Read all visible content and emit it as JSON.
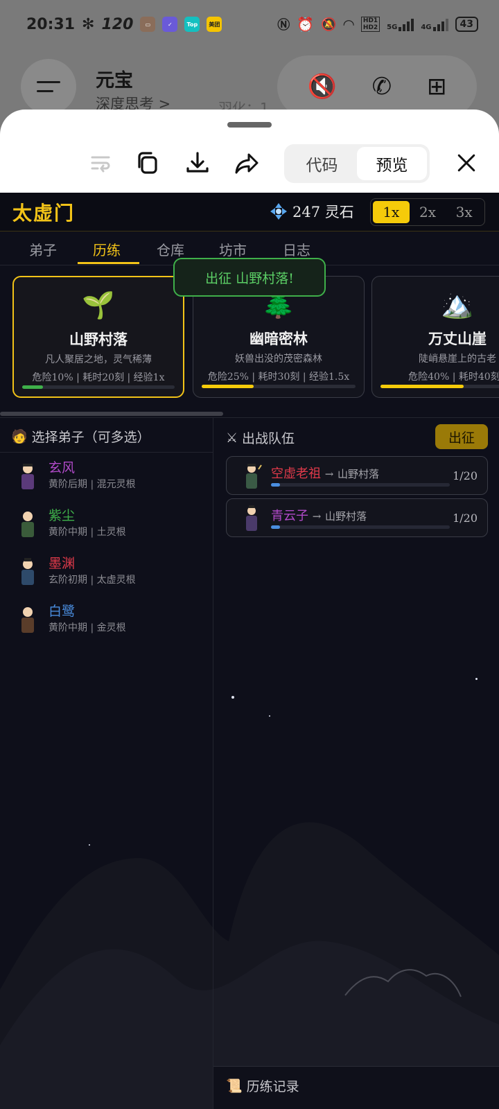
{
  "status_bar": {
    "time": "20:31",
    "refresh_rate": "120",
    "network_5g": "5G",
    "network_4g": "4G",
    "hd1": "HD1",
    "hd2": "HD2",
    "battery": "43"
  },
  "chat_header": {
    "bot_name": "元宝",
    "subtitle": "深度思考 >",
    "ghost_text": "羽化：1"
  },
  "sheet": {
    "view_tabs": [
      "代码",
      "预览"
    ],
    "active_view": "预览"
  },
  "game": {
    "sect_name": "太虚门",
    "spirit_stones": "247 灵石",
    "speed_options": [
      "1x",
      "2x",
      "3x"
    ],
    "active_speed": "1x",
    "tabs": [
      "弟子",
      "历练",
      "仓库",
      "坊市",
      "日志"
    ],
    "active_tab": "历练",
    "toast": "出征 山野村落!",
    "locations": [
      {
        "emoji": "🌱",
        "name": "山野村落",
        "desc": "凡人聚居之地，灵气稀薄",
        "stats": "危险10% | 耗时20刻 | 经验1x",
        "danger": 0.1,
        "bar_color": "#3fb04a",
        "selected": true
      },
      {
        "emoji": "🌲",
        "name": "幽暗密林",
        "desc": "妖兽出没的茂密森林",
        "stats": "危险25% | 耗时30刻 | 经验1.5x",
        "danger": 0.25,
        "bar_color": "#f5cb0a",
        "selected": false
      },
      {
        "emoji": "🏔️",
        "name": "万丈山崖",
        "desc": "陡峭悬崖上的古老",
        "stats": "危险40% | 耗时40刻 |",
        "danger": 0.4,
        "bar_color": "#f5cb0a",
        "selected": false
      }
    ],
    "select_disciples_label": "选择弟子（可多选）",
    "disciples": [
      {
        "name": "玄风",
        "info": "黄阶后期 | 混元灵根",
        "color": "#b04ac8",
        "robe": "#5b3a7a"
      },
      {
        "name": "紫尘",
        "info": "黄阶中期 | 土灵根",
        "color": "#3fb04a",
        "robe": "#3a5b3a"
      },
      {
        "name": "墨渊",
        "info": "玄阶初期 | 太虚灵根",
        "color": "#e03a4a",
        "robe": "#2e4a6a"
      },
      {
        "name": "白鹭",
        "info": "黄阶中期 | 金灵根",
        "color": "#4a8ee0",
        "robe": "#5a3d2a"
      }
    ],
    "team_label": "出战队伍",
    "dispatch_button": "出征",
    "team": [
      {
        "name": "空虚老祖",
        "name_color": "#e03a4a",
        "arrow": "→",
        "destination": "山野村落",
        "count": "1/20",
        "progress": 0.05,
        "robe": "#3a5a45"
      },
      {
        "name": "青云子",
        "name_color": "#b04ac8",
        "arrow": "→",
        "destination": "山野村落",
        "count": "1/20",
        "progress": 0.05,
        "robe": "#4a3a6a"
      }
    ],
    "log_label": "历练记录",
    "colors": {
      "accent": "#f2c318",
      "background": "#0e0f1a",
      "toast_green": "#3fb04a"
    }
  }
}
